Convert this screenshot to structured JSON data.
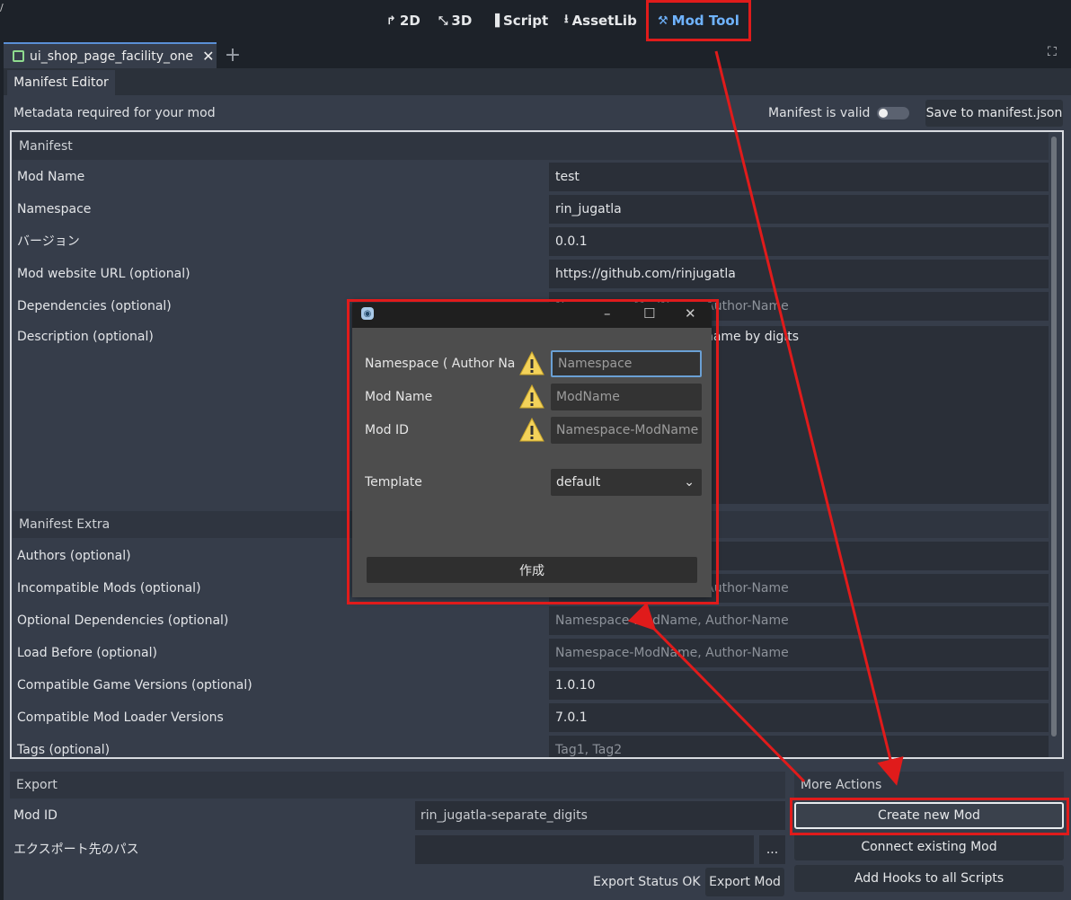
{
  "topbar": {
    "workspaces": [
      {
        "label": "2D",
        "icon": "2d-icon"
      },
      {
        "label": "3D",
        "icon": "3d-icon"
      },
      {
        "label": "Script",
        "icon": "script-icon"
      },
      {
        "label": "AssetLib",
        "icon": "assetlib-icon"
      },
      {
        "label": "Mod Tool",
        "icon": "mod-tool-icon"
      }
    ],
    "corner_mark": "/"
  },
  "tabs": {
    "scene_tab": "ui_shop_page_facility_one",
    "editor_tab": "Manifest Editor"
  },
  "header": {
    "metadata_label": "Metadata required for your mod",
    "valid_label": "Manifest is valid",
    "save_button": "Save to manifest.json"
  },
  "manifest": {
    "section": "Manifest",
    "rows": [
      {
        "label": "Mod Name",
        "value": "test"
      },
      {
        "label": "Namespace",
        "value": "rin_jugatla"
      },
      {
        "label": "バージョン",
        "value": "0.0.1"
      },
      {
        "label": "Mod website URL (optional)",
        "value": "https://github.com/rinjugatla"
      },
      {
        "label": "Dependencies (optional)",
        "value": "Namespace-ModName, Author-Name"
      },
      {
        "label": "Description (optional)",
        "value": "Separate the displayed name by digits"
      }
    ]
  },
  "manifest_extra": {
    "section": "Manifest Extra",
    "rows": [
      {
        "label": "Authors (optional)",
        "value": ""
      },
      {
        "label": "Incompatible Mods (optional)",
        "value": "Namespace-ModName, Author-Name"
      },
      {
        "label": "Optional Dependencies (optional)",
        "value": "Namespace-ModName, Author-Name"
      },
      {
        "label": "Load Before (optional)",
        "value": "Namespace-ModName, Author-Name"
      },
      {
        "label": "Compatible Game Versions (optional)",
        "value": "1.0.10"
      },
      {
        "label": "Compatible Mod Loader Versions",
        "value": "7.0.1"
      },
      {
        "label": "Tags (optional)",
        "value": "Tag1, Tag2"
      }
    ]
  },
  "export": {
    "section": "Export",
    "mod_id_label": "Mod ID",
    "mod_id_value": "rin_jugatla-separate_digits",
    "path_label": "エクスポート先のパス",
    "browse": "...",
    "status": "Export Status OK",
    "export_button": "Export Mod"
  },
  "more_actions": {
    "section": "More Actions",
    "buttons": [
      "Create new Mod",
      "Connect existing Mod",
      "Add Hooks to all Scripts"
    ]
  },
  "dialog": {
    "window_controls": [
      "–",
      "☐",
      "✕"
    ],
    "namespace_label": "Namespace ( Author Name )",
    "namespace_placeholder": "Namespace",
    "modname_label": "Mod Name",
    "modname_placeholder": "ModName",
    "modid_label": "Mod ID",
    "modid_placeholder": "Namespace-ModName",
    "template_label": "Template",
    "template_value": "default",
    "create_button": "作成"
  },
  "colors": {
    "accent": "#6fb3ff",
    "annotation": "#e01b1b",
    "panel": "#363d4a",
    "field": "#2a2f38"
  }
}
